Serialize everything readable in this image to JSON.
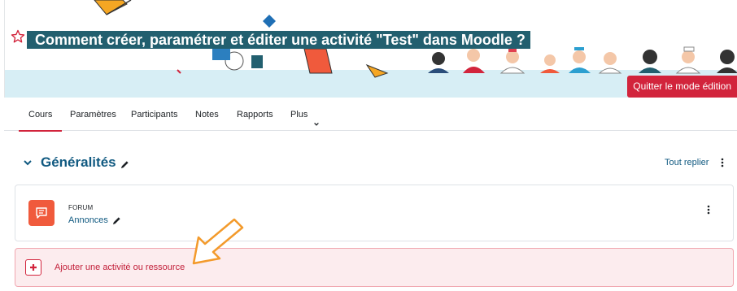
{
  "banner": {
    "title": "Comment créer, paramétrer et éditer une activité \"Test\" dans Moodle ?",
    "star_icon": "star-outline-icon",
    "quit_label": "Quitter le mode édition"
  },
  "tabs": [
    {
      "label": "Cours",
      "active": true
    },
    {
      "label": "Paramètres"
    },
    {
      "label": "Participants"
    },
    {
      "label": "Notes"
    },
    {
      "label": "Rapports"
    },
    {
      "label": "Plus",
      "icon": "chevron-down-icon"
    }
  ],
  "section": {
    "title": "Généralités",
    "collapse_label": "Tout replier"
  },
  "activity": {
    "type": "FORUM",
    "name": "Annonces",
    "icon": "forum-icon"
  },
  "add_activity": {
    "label": "Ajouter une activité ou ressource"
  },
  "colors": {
    "accent_red": "#d2243c",
    "title_bg": "#225f6f",
    "link_blue": "#115a81",
    "forum_orange": "#f05a3c",
    "annotation_arrow": "#f39a2b"
  }
}
